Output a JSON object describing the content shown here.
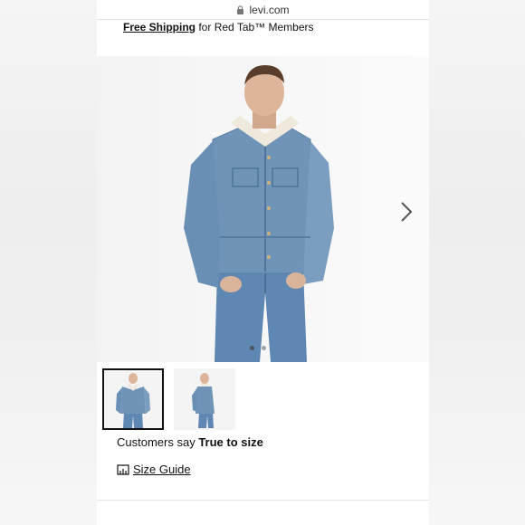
{
  "browser": {
    "url": "levi.com"
  },
  "promo": {
    "bold": "Free Shipping",
    "rest": " for Red Tab™ Members"
  },
  "product": {
    "carousel_dots": 2,
    "active_dot": 0,
    "fit_prefix": "Customers say ",
    "fit_value": "True to size",
    "size_guide": "Size Guide"
  },
  "colors": {
    "denim": "#6f94b8",
    "denim_dark": "#4f7497",
    "sherpa": "#efe8dc"
  },
  "icons": [
    "lock-icon",
    "chevron-right-icon",
    "ruler-icon"
  ]
}
